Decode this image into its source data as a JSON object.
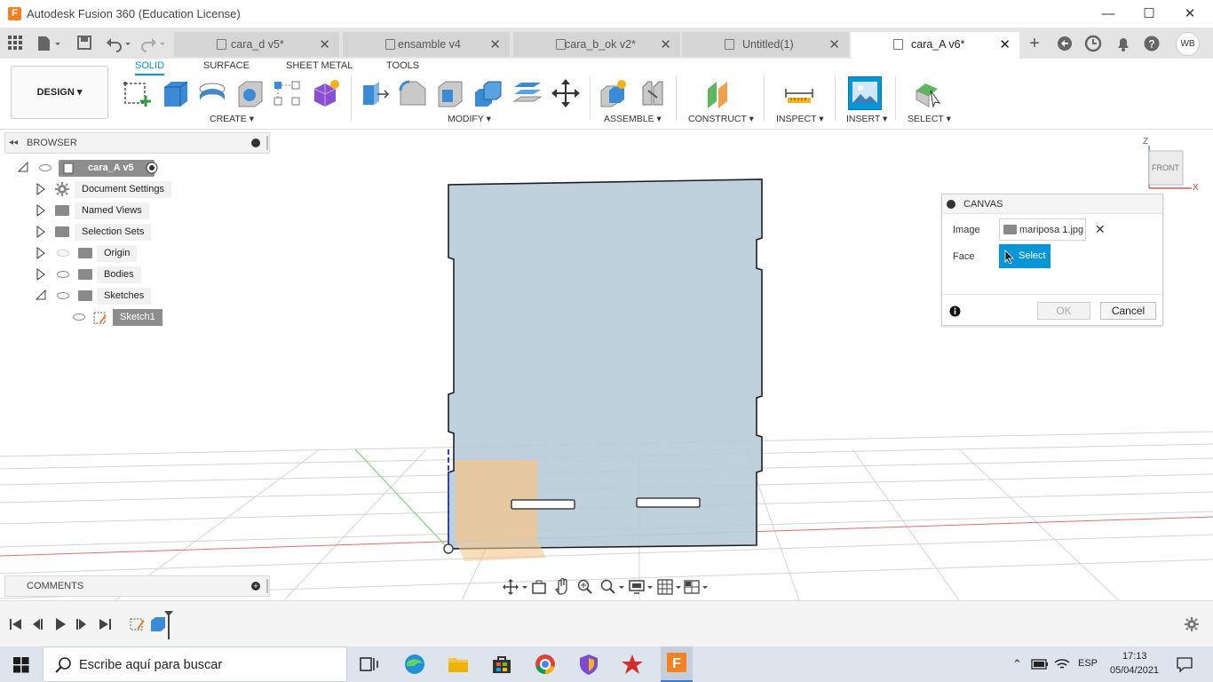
{
  "window": {
    "title": "Autodesk Fusion 360 (Education License)",
    "logo": "F"
  },
  "tabs": [
    {
      "label": "cara_d v5*",
      "active": false
    },
    {
      "label": "ensamble v4",
      "active": false
    },
    {
      "label": "cara_b_ok v2*",
      "active": false
    },
    {
      "label": "Untitled(1)",
      "active": false
    },
    {
      "label": "cara_A v6*",
      "active": true
    }
  ],
  "user_initials": "WB",
  "ribbon": {
    "tabs": [
      "SOLID",
      "SURFACE",
      "SHEET METAL",
      "TOOLS"
    ],
    "workspace": "DESIGN",
    "groups": [
      "CREATE",
      "MODIFY",
      "ASSEMBLE",
      "CONSTRUCT",
      "INSPECT",
      "INSERT",
      "SELECT"
    ]
  },
  "browser": {
    "title": "BROWSER",
    "root": "cara_A v5",
    "items": [
      "Document Settings",
      "Named Views",
      "Selection Sets",
      "Origin",
      "Bodies",
      "Sketches",
      "Sketch1"
    ]
  },
  "comments": {
    "title": "COMMENTS"
  },
  "canvas_dialog": {
    "title": "CANVAS",
    "image_label": "Image",
    "image_value": "mariposa 1.jpg",
    "face_label": "Face",
    "select_label": "Select",
    "ok_label": "OK",
    "cancel_label": "Cancel"
  },
  "viewcube": {
    "face": "FRONT",
    "axis_z": "Z",
    "axis_x": "X"
  },
  "taskbar": {
    "search_placeholder": "Escribe aquí para buscar",
    "lang": "ESP",
    "time": "17:13",
    "date": "05/04/2021"
  },
  "colors": {
    "accent": "#0696d7",
    "body_fill": "#b9ccd9",
    "sketch_fill": "#f3c78e"
  }
}
